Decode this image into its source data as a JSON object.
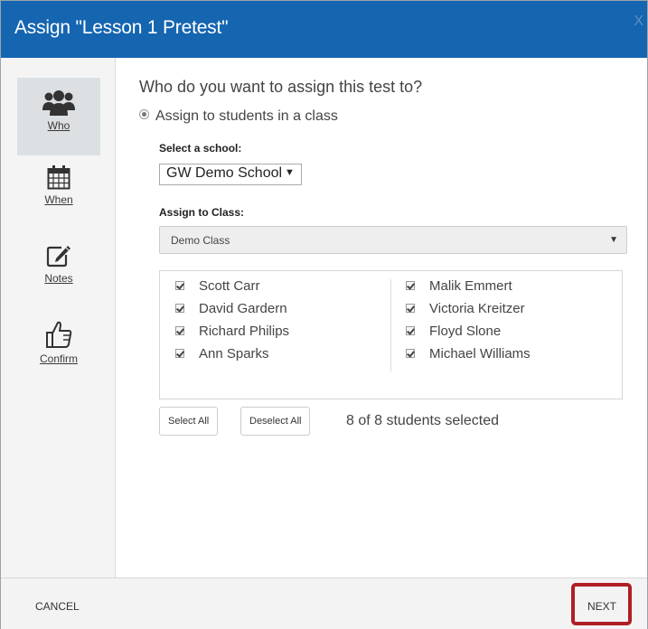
{
  "dialog": {
    "title": "Assign \"Lesson 1 Pretest\"",
    "close_label": "X"
  },
  "sidebar": {
    "items": [
      {
        "label": "Who",
        "icon": "users-icon",
        "active": true
      },
      {
        "label": "When",
        "icon": "calendar-icon",
        "active": false
      },
      {
        "label": "Notes",
        "icon": "edit-icon",
        "active": false
      },
      {
        "label": "Confirm",
        "icon": "thumbs-up-icon",
        "active": false
      }
    ]
  },
  "main": {
    "question": "Who do you want to assign this test to?",
    "assign_option": "Assign to students in a class",
    "school_label": "Select a school:",
    "school_value": "GW Demo School",
    "class_label": "Assign to Class:",
    "class_value": "Demo Class",
    "students_left": [
      "Scott Carr",
      "David Gardern",
      "Richard Philips",
      "Ann Sparks"
    ],
    "students_right": [
      "Malik Emmert",
      "Victoria Kreitzer",
      "Floyd Slone",
      "Michael Williams"
    ],
    "select_all_label": "Select All",
    "deselect_all_label": "Deselect All",
    "selected_count": "8 of 8 students selected"
  },
  "footer": {
    "cancel_label": "CANCEL",
    "next_label": "NEXT",
    "highlight_color": "#b01f24"
  },
  "colors": {
    "header": "#1565b0"
  }
}
